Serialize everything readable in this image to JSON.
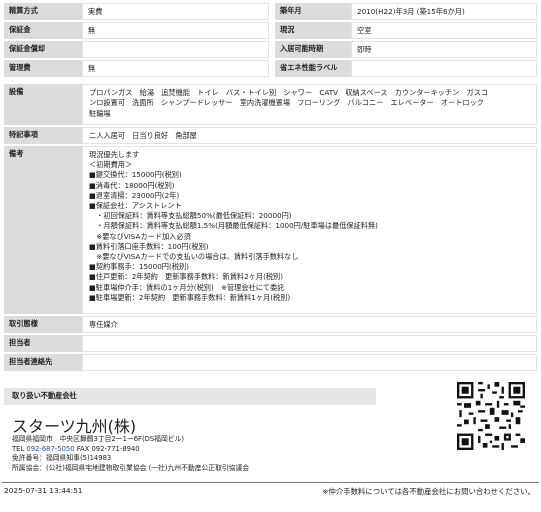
{
  "top_rows": [
    {
      "l_label": "精算方式",
      "l_value": "実費",
      "r_label": "築年月",
      "r_value": "2010(H22)年3月 (築15年6か月)"
    },
    {
      "l_label": "保証金",
      "l_value": "無",
      "r_label": "現況",
      "r_value": "空室"
    },
    {
      "l_label": "保証金償却",
      "l_value": "",
      "r_label": "入居可能時期",
      "r_value": "即時"
    },
    {
      "l_label": "管理費",
      "l_value": "無",
      "r_label": "省エネ性能ラベル",
      "r_value": ""
    }
  ],
  "equipment": {
    "label": "設備",
    "lines": [
      "プロパンガス　給湯　追焚機能　トイレ　バス・トイレ別　シャワー　CATV　収納スペース　カウンターキッチン　ガスコ",
      "ンロ設置可　洗面所　シャンプードレッサー　室内洗濯機置場　フローリング　バルコニー　エレベーター　オートロック",
      "駐輪場"
    ]
  },
  "features": {
    "label": "特記事項",
    "value": "二人入居可　日当り良好　角部屋"
  },
  "notes": {
    "label": "備考",
    "lines": [
      "現況優先します",
      "＜初期費用＞",
      "■鍵交換代：15000円(税別)",
      "■消毒代：18000円(税別)",
      "■退室清掃：23000円(2年)",
      "■保証会社：アシストレント",
      "　・初回保証料：賃料等支払総額50%(最低保証料：20000円)",
      "　・月額保証料：賃料等支払総額1.5%(月額最低保証料：1000円/駐車場は最低保証料無)",
      "　※要なびVISAカード加入必須",
      "■賃料引落口座手数料：100円(税別)",
      "　※要なびVISAカードでの支払いの場合は、賃料引落手数料なし",
      "■契約事務手：15000円(税別)",
      "■住戸更新：2年契約　更新事務手数料：新賃料2ヶ月(税別)",
      "",
      "■駐車場仲介手：賃料の1ヶ月分(税別)　※管理会社にて委託",
      "■駐車場更新：2年契約　更新事務手数料：新賃料1ヶ月(税別)"
    ]
  },
  "transaction": {
    "label": "取引態様",
    "value": "専任媒介"
  },
  "staff": {
    "label": "担当者",
    "value": ""
  },
  "staff_contact": {
    "label": "担当者連絡先",
    "value": ""
  },
  "company": {
    "heading": "取り扱い不動産会社",
    "name": "スターツ九州(株)",
    "address": "福岡県福岡市　中央区舞鶴3丁目2ー1ー6F(DS福岡ビル)",
    "tel_prefix": "TEL ",
    "tel": "092-687-5050",
    "fax": " FAX 092-771-8940",
    "license": "免許番号：福岡県知事(5)14983",
    "association": "所属協会：(公社)福岡県宅地建物取引業協会 (一社)九州不動産公正取引協議会",
    "qr_icon": "qr-code-icon"
  },
  "footer": {
    "datetime": "2025-07-31 13:44:51",
    "note": "※仲介手数料については各不動産会社にお問い合わせください。"
  }
}
